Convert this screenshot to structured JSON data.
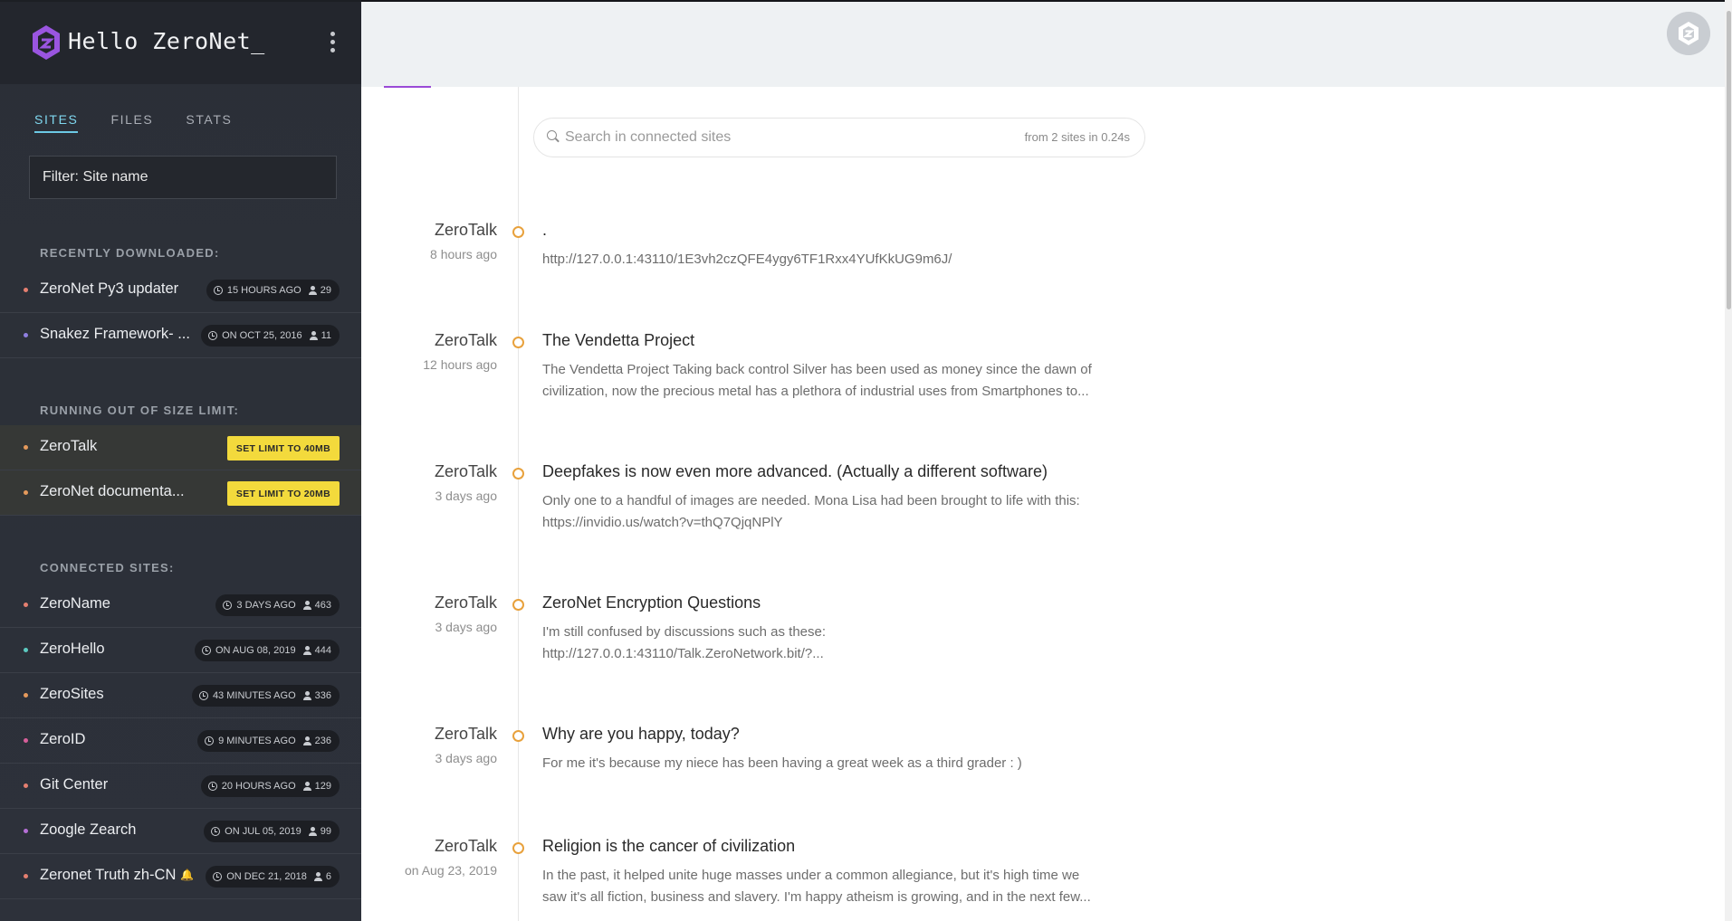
{
  "sidebar": {
    "title": "Hello ZeroNet_",
    "tabs": [
      "SITES",
      "FILES",
      "STATS"
    ],
    "filter_placeholder": "Filter: Site name",
    "sections": {
      "recent": "RECENTLY DOWNLOADED:",
      "limit": "RUNNING OUT OF SIZE LIMIT:",
      "connected": "CONNECTED SITES:"
    },
    "recent": [
      {
        "name": "ZeroNet Py3 updater",
        "time": "15 HOURS AGO",
        "peers": "29",
        "dot": "#e57f70"
      },
      {
        "name": "Snakez Framework- ...",
        "time": "ON OCT 25, 2016",
        "peers": "11",
        "dot": "#8f7fe0"
      }
    ],
    "limit": [
      {
        "name": "ZeroTalk",
        "button": "SET LIMIT TO 40MB",
        "dot": "#e59a5c"
      },
      {
        "name": "ZeroNet documenta...",
        "button": "SET LIMIT TO 20MB",
        "dot": "#e59a5c"
      }
    ],
    "connected": [
      {
        "name": "ZeroName",
        "time": "3 DAYS AGO",
        "peers": "463",
        "dot": "#e57f70"
      },
      {
        "name": "ZeroHello",
        "time": "ON AUG 08, 2019",
        "peers": "444",
        "dot": "#5cc9c0"
      },
      {
        "name": "ZeroSites",
        "time": "43 MINUTES AGO",
        "peers": "336",
        "dot": "#e59a5c"
      },
      {
        "name": "ZeroID",
        "time": "9 MINUTES AGO",
        "peers": "236",
        "dot": "#d75f9a"
      },
      {
        "name": "Git Center",
        "time": "20 HOURS AGO",
        "peers": "129",
        "dot": "#e57f70"
      },
      {
        "name": "Zoogle Zearch",
        "time": "ON JUL 05, 2019",
        "peers": "99",
        "dot": "#b56fd6"
      },
      {
        "name": "Zeronet Truth zh-CN",
        "time": "ON DEC 21, 2018",
        "peers": "6",
        "dot": "#e57f70",
        "bell": "🔔"
      }
    ]
  },
  "search": {
    "placeholder": "Search in connected sites",
    "stats": "from 2 sites in 0.24s"
  },
  "feed": [
    {
      "site": "ZeroTalk",
      "time": "8 hours ago",
      "title": ".",
      "body": "http://127.0.0.1:43110/1E3vh2czQFE4ygy6TF1Rxx4YUfKkUG9m6J/"
    },
    {
      "site": "ZeroTalk",
      "time": "12 hours ago",
      "title": "The Vendetta Project",
      "body": "The Vendetta Project Taking back control Silver has been used as money since the dawn of civilization, now the precious metal has a plethora of industrial uses from Smartphones to..."
    },
    {
      "site": "ZeroTalk",
      "time": "3 days ago",
      "title": "Deepfakes is now even more advanced. (Actually a different software)",
      "body": "Only one to a handful of images are needed. Mona Lisa had been brought to life with this: https://invidio.us/watch?v=thQ7QjqNPlY"
    },
    {
      "site": "ZeroTalk",
      "time": "3 days ago",
      "title": "ZeroNet Encryption Questions",
      "body": "I'm still confused by discussions such as these: http://127.0.0.1:43110/Talk.ZeroNetwork.bit/?..."
    },
    {
      "site": "ZeroTalk",
      "time": "3 days ago",
      "title": "Why are you happy, today?",
      "body": "For me it's because my niece has been having a great week as a third grader : )"
    },
    {
      "site": "ZeroTalk",
      "time": "on Aug 23, 2019",
      "title": "Religion is the cancer of civilization",
      "body": "In the past, it helped unite huge masses under a common allegiance, but it's high time we saw it's all fiction, business and slavery. I'm happy atheism is growing, and in the next few..."
    }
  ]
}
